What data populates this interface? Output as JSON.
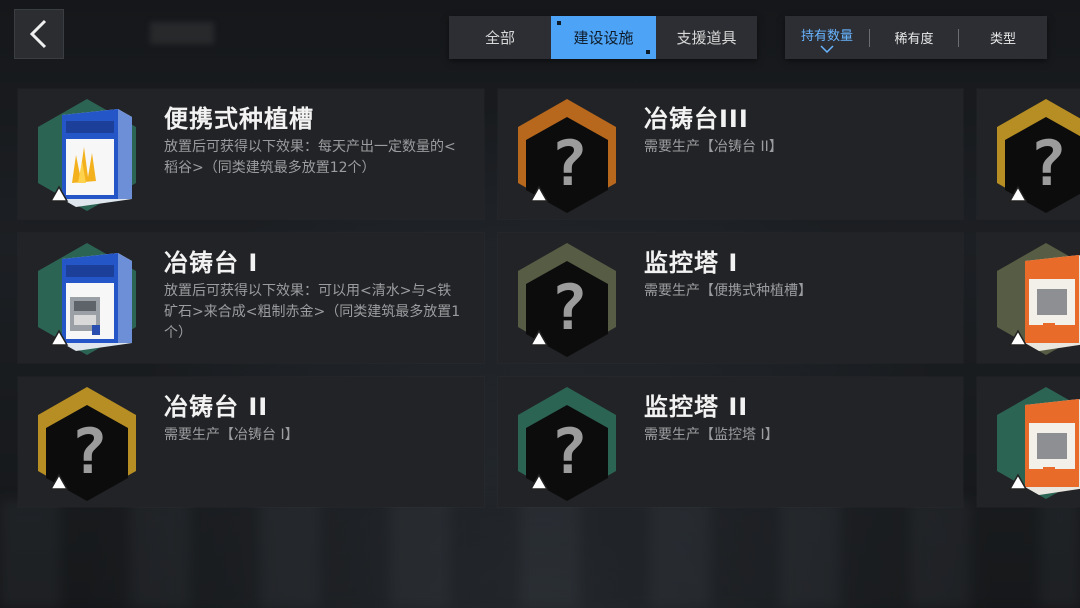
{
  "tabs": [
    "全部",
    "建设设施",
    "支援道具"
  ],
  "active_tab": "建设设施",
  "sort_options": [
    "持有数量",
    "稀有度",
    "类型"
  ],
  "colors": {
    "accent": "#4da3f5",
    "orange": "#c9701c",
    "yellow": "#c89a24",
    "teal": "#2e6b5a",
    "olive": "#5d6448"
  },
  "cards": [
    {
      "title": "便携式种植槽",
      "desc": "放置后可获得以下效果：每天产出一定数量的<稻谷>（同类建筑最多放置12个）",
      "icon": "planter-box-icon",
      "hex_color": "#2e6b5a"
    },
    {
      "title": "冶铸台III",
      "desc": "需要生产【冶铸台 II】",
      "icon": "question-mark-icon",
      "hex_color": "#c9701c"
    },
    {
      "title": "冶铸台 I",
      "desc": "放置后可获得以下效果：可以用<清水>与<铁矿石>来合成<粗制赤金>（同类建筑最多放置1个）",
      "icon": "forge-box-icon",
      "hex_color": "#2e6b5a"
    },
    {
      "title": "监控塔 I",
      "desc": "需要生产【便携式种植槽】",
      "icon": "question-mark-icon",
      "hex_color": "#5d6448"
    },
    {
      "title": "冶铸台 II",
      "desc": "需要生产【冶铸台 I】",
      "icon": "question-mark-icon",
      "hex_color": "#c89a24"
    },
    {
      "title": "监控塔 II",
      "desc": "需要生产【监控塔 I】",
      "icon": "question-mark-icon",
      "hex_color": "#2e6b5a"
    }
  ],
  "side_cards": [
    {
      "icon": "question-mark-icon",
      "hex_color": "#c89a24"
    },
    {
      "icon": "orange-box-icon",
      "hex_color": "#5d6448"
    },
    {
      "icon": "orange-box-icon",
      "hex_color": "#2e6b5a"
    }
  ]
}
